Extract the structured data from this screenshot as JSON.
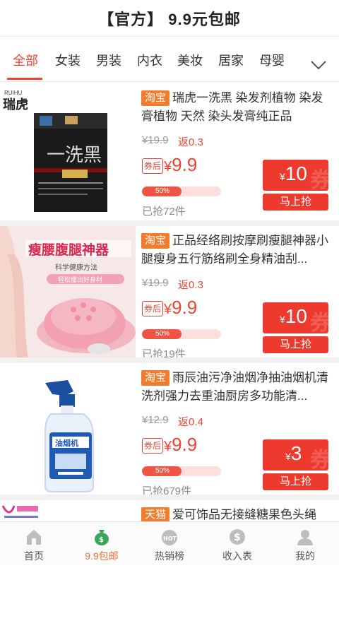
{
  "header": {
    "title": "【官方】 9.9元包邮"
  },
  "tabs": [
    {
      "label": "全部",
      "active": true
    },
    {
      "label": "女装"
    },
    {
      "label": "男装"
    },
    {
      "label": "内衣"
    },
    {
      "label": "美妆"
    },
    {
      "label": "居家"
    },
    {
      "label": "母婴"
    }
  ],
  "tabs_more_icon": "chevron-down-icon",
  "items": [
    {
      "platform": "淘宝",
      "name": "瑞虎一洗黑 染发剂植物 染发膏植物 天然 染头发膏纯正品",
      "original_price": "¥19.9",
      "rebate": "返0.3",
      "coupon_tag": "券后",
      "price": "9.9",
      "progress_label": "50%",
      "progress": 0.5,
      "sold": "已抢72件",
      "coupon_amount": "10",
      "grab_label": "马上抢",
      "image_brand": "瑞虎",
      "image_brand_en": "RUIHU",
      "image_box_text": "一洗黑"
    },
    {
      "platform": "淘宝",
      "name": "正品经络刷按摩刷瘦腿神器小腿瘦身五行筋络刷全身精油刮...",
      "original_price": "¥19.9",
      "rebate": "返0.3",
      "coupon_tag": "券后",
      "price": "9.9",
      "progress_label": "50%",
      "progress": 0.5,
      "sold": "已抢19件",
      "coupon_amount": "10",
      "grab_label": "马上抢",
      "image_title": "瘦腰腹腿神器",
      "image_sub1": "科学健康方法",
      "image_sub2": "轻松瘦出好身材"
    },
    {
      "platform": "淘宝",
      "name": "雨辰油污净油烟净抽油烟机清洗剂强力去重油厨房多功能清...",
      "original_price": "¥12.9",
      "rebate": "返0.4",
      "coupon_tag": "券后",
      "price": "9.9",
      "progress_label": "50%",
      "progress": 0.5,
      "sold": "已抢679件",
      "coupon_amount": "3",
      "grab_label": "马上抢",
      "image_label": "油烟机"
    },
    {
      "platform": "天猫",
      "name": "爱可饰品无接缝糖果色头绳"
    }
  ],
  "bottom_nav": [
    {
      "label": "首页",
      "icon": "home-icon"
    },
    {
      "label": "9.9包邮",
      "icon": "money-bag-icon",
      "active": true
    },
    {
      "label": "热销榜",
      "icon": "hot-icon"
    },
    {
      "label": "收入表",
      "icon": "dollar-coin-icon"
    },
    {
      "label": "我的",
      "icon": "user-icon"
    }
  ],
  "colors": {
    "accent": "#ee4433",
    "platform_tag": "#f07c2e",
    "nav_active": "#e8733a"
  }
}
